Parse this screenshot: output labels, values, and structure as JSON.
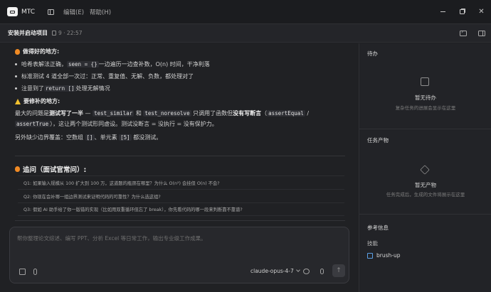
{
  "app": {
    "name": "MTC",
    "menu": [
      "编辑(E)",
      "帮助(H)"
    ]
  },
  "topbar": {
    "project_title": "安装并启动项目",
    "meta": "9 · 22:57"
  },
  "chat": {
    "good_heading": "做得好的地方:",
    "good_items": [
      [
        "哈希表解法正确，",
        "seen = {}",
        " 一边遍历一边查补数，O(n) 时间，干净利落"
      ],
      [
        "标准测试 4 道全部一次过：正常、重复值、无解、负数，都处理对了"
      ],
      [
        "注意到了 ",
        "return []",
        " 处理无解情况"
      ]
    ],
    "fix_heading": "要修补的地方:",
    "fix_para1_a": "最大的问题是",
    "fix_para1_b": "测试写了一半",
    "fix_para1_c": " — ",
    "fix_para1_code1": "test_similar",
    "fix_para1_d": " 和 ",
    "fix_para1_code2": "test_noresolve",
    "fix_para1_e": " 只调用了函数但",
    "fix_para1_f": "没有写断言",
    "fix_para1_g": "（",
    "fix_para1_code3": "assertEqual",
    "fix_para1_h": " / ",
    "fix_para1_code4": "assertTrue",
    "fix_para1_i": "），这让两个测试形同虚设。测试没断言 = 没执行 = 没有保护力。",
    "fix_para2_a": "另外缺少边界覆盖：空数组 ",
    "fix_para2_code1": "[]",
    "fix_para2_b": "、单元素 ",
    "fix_para2_code2": "[5]",
    "fix_para2_c": " 都没测试。",
    "followup_heading": "追问（面试官常问）:",
    "questions": [
      "Q1: 如果输入规模从 100 扩大到 100 万，这道题的瓶颈在哪里？为什么 O(n²) 会挂但 O(n) 不会?",
      "Q2: 你现在会补哪一组边界测试来证明代码的可靠性？为什么选这组?",
      "Q3: 假如 AI 助手给了你一版错的实现（比如用双重循环但忘了 break），你先看代码的哪一段来判断靠不靠谱?"
    ]
  },
  "input": {
    "placeholder": "帮你整理论文综述、编写 PPT、分析 Excel 等日常工作，输出专业级工作成果。",
    "model": "claude-opus-4-7",
    "send": "↑"
  },
  "right_panel": {
    "todo_heading": "待办",
    "todo_empty_title": "暂无待办",
    "todo_empty_sub": "复杂任务的进展会显示在这里",
    "artifacts_heading": "任务产物",
    "artifacts_empty_title": "暂无产物",
    "artifacts_empty_sub": "任务完成后，生成的文件将展示在这里",
    "refs_heading": "参考信息",
    "skills_label": "技能",
    "skill_name": "brush-up"
  }
}
